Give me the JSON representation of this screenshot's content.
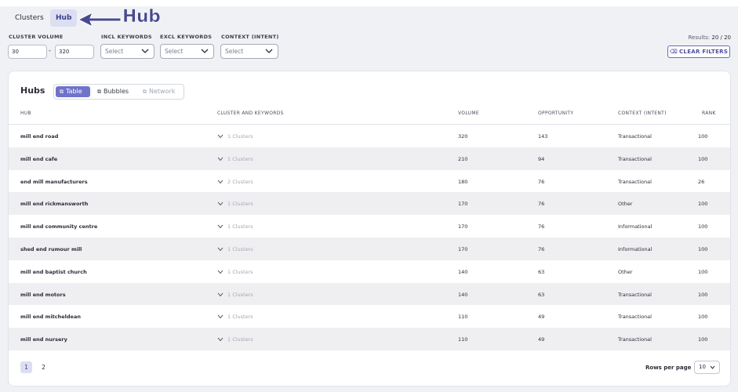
{
  "tabs": {
    "clusters": "Clusters",
    "hub": "Hub"
  },
  "annotation": {
    "text": "Hub"
  },
  "filters": {
    "cluster_volume_label": "CLUSTER VOLUME",
    "volume_min": "30",
    "volume_dash": "-",
    "volume_max": "320",
    "incl_label": "INCL KEYWORDS",
    "incl_value": "Select",
    "excl_label": "EXCL KEYWORDS",
    "excl_value": "Select",
    "context_label": "CONTEXT (INTENT)",
    "context_value": "Select"
  },
  "results": {
    "label": "Results:",
    "value": "20 / 20"
  },
  "clear_filters": "CLEAR FILTERS",
  "card": {
    "title": "Hubs",
    "views": {
      "table": "Table",
      "bubbles": "Bubbles",
      "network": "Network"
    }
  },
  "table": {
    "headers": {
      "hub": "HUB",
      "cluster": "CLUSTER AND KEYWORDS",
      "volume": "VOLUME",
      "opportunity": "OPPORTUNITY",
      "context": "CONTEXT (INTENT)",
      "rank": "RANK"
    },
    "rows": [
      {
        "hub": "mill end road",
        "clusters": "1 Clusters",
        "volume": "320",
        "opportunity": "143",
        "context": "Transactional",
        "rank": "100"
      },
      {
        "hub": "mill end cafe",
        "clusters": "1 Clusters",
        "volume": "210",
        "opportunity": "94",
        "context": "Transactional",
        "rank": "100"
      },
      {
        "hub": "end mill manufacturers",
        "clusters": "2 Clusters",
        "volume": "180",
        "opportunity": "76",
        "context": "Transactional",
        "rank": "26"
      },
      {
        "hub": "mill end rickmansworth",
        "clusters": "1 Clusters",
        "volume": "170",
        "opportunity": "76",
        "context": "Other",
        "rank": "100"
      },
      {
        "hub": "mill end community centre",
        "clusters": "1 Clusters",
        "volume": "170",
        "opportunity": "76",
        "context": "Informational",
        "rank": "100"
      },
      {
        "hub": "shed end rumour mill",
        "clusters": "1 Clusters",
        "volume": "170",
        "opportunity": "76",
        "context": "Informational",
        "rank": "100"
      },
      {
        "hub": "mill end baptist church",
        "clusters": "1 Clusters",
        "volume": "140",
        "opportunity": "63",
        "context": "Other",
        "rank": "100"
      },
      {
        "hub": "mill end motors",
        "clusters": "1 Clusters",
        "volume": "140",
        "opportunity": "63",
        "context": "Transactional",
        "rank": "100"
      },
      {
        "hub": "mill end mitcheldean",
        "clusters": "1 Clusters",
        "volume": "110",
        "opportunity": "49",
        "context": "Transactional",
        "rank": "100"
      },
      {
        "hub": "mill end nursery",
        "clusters": "1 Clusters",
        "volume": "110",
        "opportunity": "49",
        "context": "Transactional",
        "rank": "100"
      }
    ]
  },
  "pagination": {
    "pages": [
      "1",
      "2"
    ],
    "rows_per_page_label": "Rows per page",
    "rows_per_page_value": "10"
  },
  "colors": {
    "accent": "#6f73c9",
    "annotation": "#474a8f"
  },
  "icons": {
    "view_icon": "table-grid-icon",
    "clear_icon": "filter-clear-icon",
    "chevron": "chevron-down-icon",
    "arrow": "arrow-left-icon"
  }
}
